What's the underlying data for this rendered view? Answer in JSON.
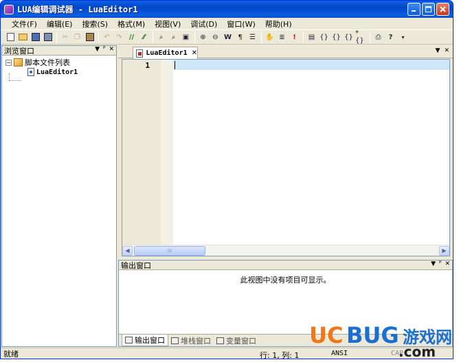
{
  "window": {
    "title": "LUA编辑调试器 - LuaEditor1"
  },
  "menu": [
    "文件(F)",
    "编辑(E)",
    "搜索(S)",
    "格式(M)",
    "视图(V)",
    "调试(D)",
    "窗口(W)",
    "帮助(H)"
  ],
  "toolbar_icons": [
    "new-file-icon",
    "open-folder-icon",
    "save-icon",
    "save-all-icon",
    "cut-icon",
    "copy-icon",
    "paste-icon",
    "undo-icon",
    "redo-icon",
    "comment-icon",
    "uncomment-icon",
    "find-icon",
    "find-next-icon",
    "find-in-files-icon",
    "zoom-in-icon",
    "zoom-out-icon",
    "word-wrap-icon",
    "paragraph-icon",
    "indent-icon",
    "hand-icon",
    "list-icon",
    "break-icon",
    "breakpoint-icon",
    "step-into-icon",
    "step-over-icon",
    "step-out-icon",
    "print-icon",
    "help-icon"
  ],
  "left_panel": {
    "title": "浏览窗口",
    "tree_root": "脚本文件列表",
    "tree_child": "LuaEditor1"
  },
  "editor": {
    "tab_label": "LuaEditor1",
    "line_number": "1",
    "scroll_thumb_grip": "III"
  },
  "output_panel": {
    "title": "输出窗口",
    "empty_message": "此视图中没有项目可显示。",
    "tabs": [
      "输出窗口",
      "堆栈窗口",
      "变量窗口"
    ]
  },
  "status": {
    "ready": "就绪",
    "position": "行: 1, 列: 1",
    "encoding": "ANSI",
    "cap": "CAP"
  },
  "watermark": {
    "brand_u": "UC",
    "brand_b": "BUG",
    "cn": "游戏网",
    "suffix": ".com"
  },
  "colors": {
    "titlebar": "#0a5fe3",
    "chrome": "#ece9d8",
    "current_line": "#cfe6f7",
    "watermark_orange": "#f07818",
    "watermark_blue": "#1a6fd0"
  }
}
